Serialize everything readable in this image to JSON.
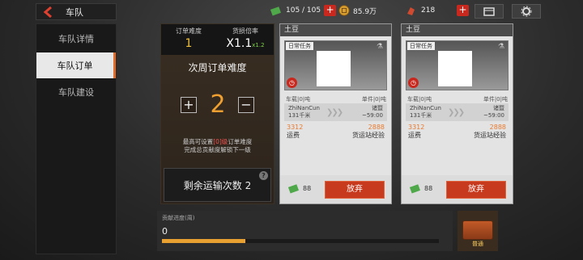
{
  "header": {
    "title": "车队"
  },
  "resources": {
    "tickets": "105 / 105",
    "coins": "85.9万",
    "tokens": "218"
  },
  "sidebar": {
    "items": [
      {
        "label": "车队详情"
      },
      {
        "label": "车队订单"
      },
      {
        "label": "车队建设"
      }
    ]
  },
  "difficulty": {
    "order_label": "订单难度",
    "order_value": "1",
    "reward_label": "货损倍率",
    "reward_value": "X1.1",
    "reward_next": "x1.2",
    "title": "次周订单难度",
    "minus": "−",
    "plus": "+",
    "value": "2",
    "note1_a": "最高可设置",
    "note1_b": "[0]级",
    "note1_c": "订单难度",
    "note2": "完成总贡献度解锁下一级",
    "remaining": "剩余运输次数 2",
    "help": "?"
  },
  "cards": [
    {
      "name": "土豆",
      "tag": "日常任务",
      "cargo_label": "车载|0|吨",
      "unit_label": "单件|0|吨",
      "from": "ZhiNanCun",
      "distance": "131千米",
      "to": "诸暨",
      "time": "~59:00",
      "fee": "3312",
      "fee_label": "运费",
      "exp": "2888",
      "exp_label": "货运站经验",
      "tickets": "88",
      "abandon": "放弃"
    },
    {
      "name": "土豆",
      "tag": "日常任务",
      "cargo_label": "车载|0|吨",
      "unit_label": "单件|0|吨",
      "from": "ZhiNanCun",
      "distance": "131千米",
      "to": "诸暨",
      "time": "~59:00",
      "fee": "3312",
      "fee_label": "运费",
      "exp": "2888",
      "exp_label": "货运站经验",
      "tickets": "88",
      "abandon": "放弃"
    }
  ],
  "progress": {
    "label": "贡献进度(周)",
    "value": "0",
    "fill_fraction": 0.3
  },
  "reward_box": {
    "label": "普通"
  },
  "colors": {
    "accent": "#e06a28",
    "danger": "#c8281e",
    "gold": "#f0c040"
  }
}
